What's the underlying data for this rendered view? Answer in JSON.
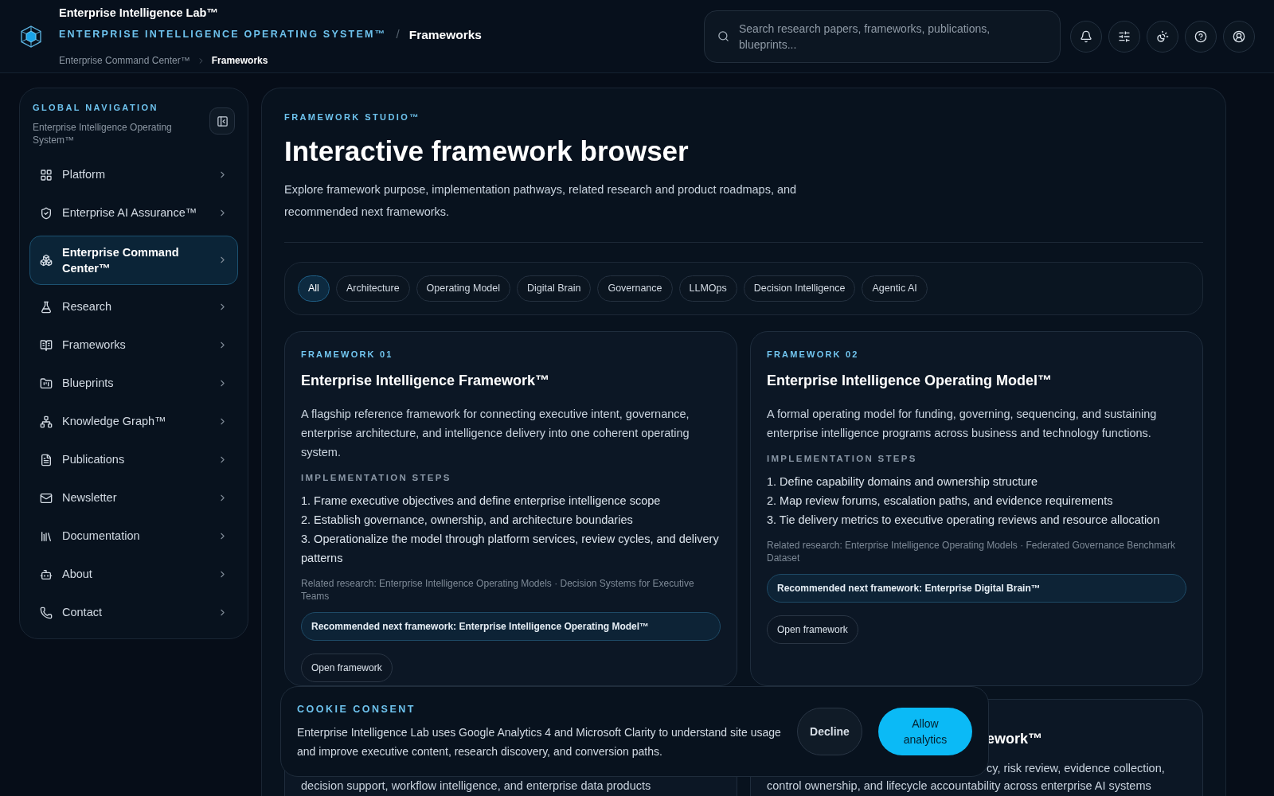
{
  "header": {
    "brand": "Enterprise Intelligence Lab™",
    "system": "ENTERPRISE INTELLIGENCE OPERATING SYSTEM™",
    "separator": "/",
    "page": "Frameworks",
    "breadcrumbs": [
      {
        "label": "Enterprise Command Center™",
        "current": false
      },
      {
        "label": "Frameworks",
        "current": true
      }
    ],
    "search": {
      "placeholder": "Search research papers, frameworks, publications, blueprints..."
    }
  },
  "sidebar": {
    "heading": "GLOBAL NAVIGATION",
    "subheading": "Enterprise Intelligence Operating System™",
    "items": [
      {
        "label": "Platform",
        "selected": false
      },
      {
        "label": "Enterprise AI Assurance™",
        "selected": false
      },
      {
        "label": "Enterprise Command Center™",
        "selected": true
      },
      {
        "label": "Research",
        "selected": false
      },
      {
        "label": "Frameworks",
        "selected": false
      },
      {
        "label": "Blueprints",
        "selected": false
      },
      {
        "label": "Knowledge Graph™",
        "selected": false
      },
      {
        "label": "Publications",
        "selected": false
      },
      {
        "label": "Newsletter",
        "selected": false
      },
      {
        "label": "Documentation",
        "selected": false
      },
      {
        "label": "About",
        "selected": false
      },
      {
        "label": "Contact",
        "selected": false
      }
    ]
  },
  "main": {
    "eyebrow": "FRAMEWORK STUDIO™",
    "title": "Interactive framework browser",
    "description": "Explore framework purpose, implementation pathways, related research and product roadmaps, and recommended next frameworks.",
    "filters": [
      {
        "label": "All",
        "selected": true
      },
      {
        "label": "Architecture",
        "selected": false
      },
      {
        "label": "Operating Model",
        "selected": false
      },
      {
        "label": "Digital Brain",
        "selected": false
      },
      {
        "label": "Governance",
        "selected": false
      },
      {
        "label": "LLMOps",
        "selected": false
      },
      {
        "label": "Decision Intelligence",
        "selected": false
      },
      {
        "label": "Agentic AI",
        "selected": false
      }
    ],
    "cards": [
      {
        "eyebrow": "FRAMEWORK 01",
        "title": "Enterprise Intelligence Framework™",
        "description": "A flagship reference framework for connecting executive intent, governance, enterprise architecture, and intelligence delivery into one coherent operating system.",
        "steps_heading": "IMPLEMENTATION STEPS",
        "steps": [
          "1. Frame executive objectives and define enterprise intelligence scope",
          "2. Establish governance, ownership, and architecture boundaries",
          "3. Operationalize the model through platform services, review cycles, and delivery patterns"
        ],
        "related": "Related research: Enterprise Intelligence Operating Models · Decision Systems for Executive Teams",
        "recommended": "Recommended next framework: Enterprise Intelligence Operating Model™",
        "action": "Open framework"
      },
      {
        "eyebrow": "FRAMEWORK 02",
        "title": "Enterprise Intelligence Operating Model™",
        "description": "A formal operating model for funding, governing, sequencing, and sustaining enterprise intelligence programs across business and technology functions.",
        "steps_heading": "IMPLEMENTATION STEPS",
        "steps": [
          "1. Define capability domains and ownership structure",
          "2. Map review forums, escalation paths, and evidence requirements",
          "3. Tie delivery metrics to executive operating reviews and resource allocation"
        ],
        "related": "Related research: Enterprise Intelligence Operating Models · Federated Governance Benchmark Dataset",
        "recommended": "Recommended next framework: Enterprise Digital Brain™",
        "action": "Open framework"
      }
    ],
    "partial_cards": [
      {
        "lines": [
          "decision support, workflow intelligence, and enterprise data products"
        ]
      },
      {
        "title": "ework™",
        "lines": [
          "cy, risk review, evidence collection,",
          "control ownership, and lifecycle accountability across enterprise AI systems"
        ]
      }
    ]
  },
  "cookie_banner": {
    "title": "COOKIE CONSENT",
    "text": "Enterprise Intelligence Lab uses Google Analytics 4 and Microsoft Clarity to understand site usage and improve executive content, research discovery, and conversion paths.",
    "buttons": [
      {
        "label": "Decline",
        "kind": "secondary"
      },
      {
        "label": "Allow analytics",
        "kind": "primary"
      }
    ]
  }
}
